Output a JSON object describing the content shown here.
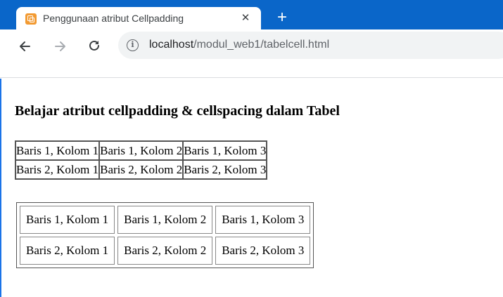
{
  "browser": {
    "tab_title": "Penggunaan atribut Cellpadding",
    "tab_close": "✕",
    "new_tab": "+",
    "url_host": "localhost",
    "url_path": "/modul_web1/tabelcell.html",
    "favicon": "html-file-icon",
    "colors": {
      "tabstrip": "#0a66c9",
      "favicon": "#f29a32"
    }
  },
  "page": {
    "heading": "Belajar atribut cellpadding & cellspacing dalam Tabel",
    "table1": {
      "rows": [
        [
          "Baris 1, Kolom 1",
          "Baris 1, Kolom 2",
          "Baris 1, Kolom 3"
        ],
        [
          "Baris 2, Kolom 1",
          "Baris 2, Kolom 2",
          "Baris 2, Kolom 3"
        ]
      ]
    },
    "table2": {
      "rows": [
        [
          "Baris 1, Kolom 1",
          "Baris 1, Kolom 2",
          "Baris 1, Kolom 3"
        ],
        [
          "Baris 2, Kolom 1",
          "Baris 2, Kolom 2",
          "Baris 2, Kolom 3"
        ]
      ]
    }
  }
}
